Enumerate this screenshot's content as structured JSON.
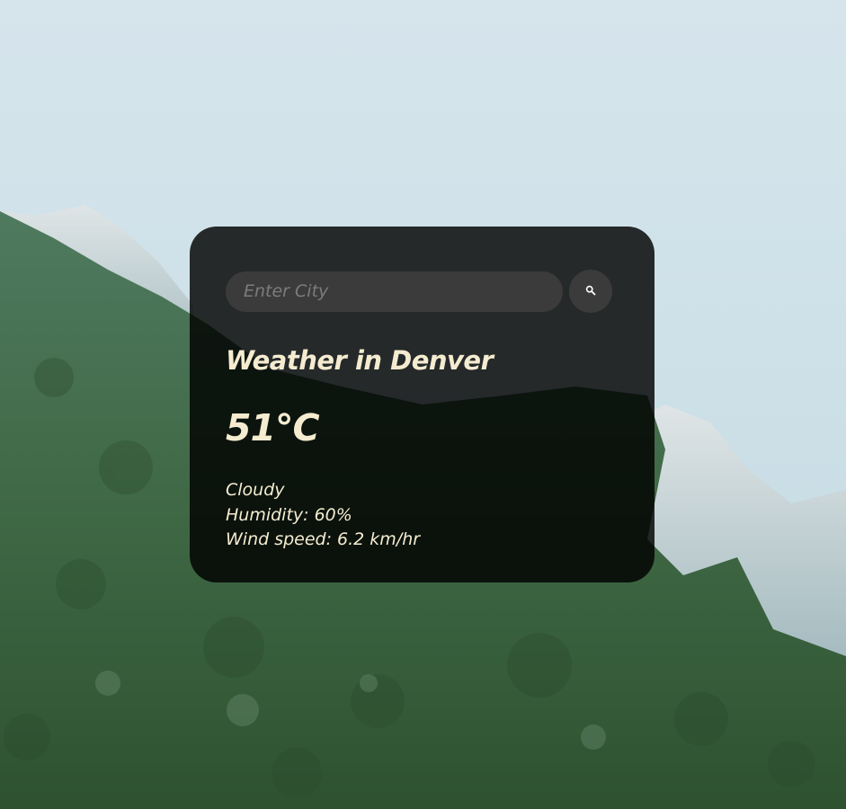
{
  "search": {
    "placeholder": "Enter City",
    "button_icon": "search-icon"
  },
  "weather": {
    "city_heading": "Weather in Denver",
    "temperature": "51°C",
    "description": "Cloudy",
    "humidity": "Humidity: 60%",
    "wind": "Wind speed: 6.2 km/hr"
  },
  "colors": {
    "card_background": "#000000",
    "text": "#f5ecd0",
    "input_background": "#3b3b3b",
    "placeholder": "#7c7c7c"
  }
}
